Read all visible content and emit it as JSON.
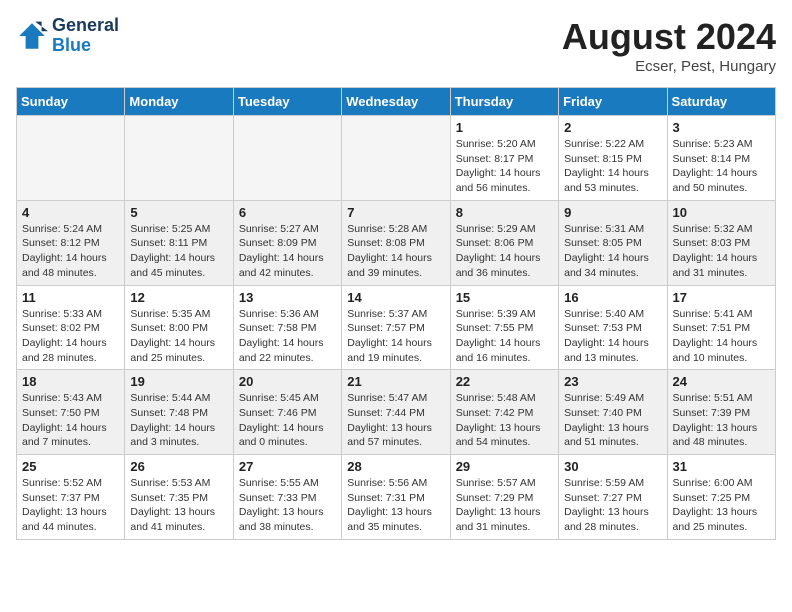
{
  "header": {
    "logo_line1": "General",
    "logo_line2": "Blue",
    "month": "August 2024",
    "location": "Ecser, Pest, Hungary"
  },
  "weekdays": [
    "Sunday",
    "Monday",
    "Tuesday",
    "Wednesday",
    "Thursday",
    "Friday",
    "Saturday"
  ],
  "weeks": [
    [
      {
        "day": "",
        "empty": true
      },
      {
        "day": "",
        "empty": true
      },
      {
        "day": "",
        "empty": true
      },
      {
        "day": "",
        "empty": true
      },
      {
        "day": "1",
        "sunrise": "Sunrise: 5:20 AM",
        "sunset": "Sunset: 8:17 PM",
        "daylight": "Daylight: 14 hours and 56 minutes."
      },
      {
        "day": "2",
        "sunrise": "Sunrise: 5:22 AM",
        "sunset": "Sunset: 8:15 PM",
        "daylight": "Daylight: 14 hours and 53 minutes."
      },
      {
        "day": "3",
        "sunrise": "Sunrise: 5:23 AM",
        "sunset": "Sunset: 8:14 PM",
        "daylight": "Daylight: 14 hours and 50 minutes."
      }
    ],
    [
      {
        "day": "4",
        "sunrise": "Sunrise: 5:24 AM",
        "sunset": "Sunset: 8:12 PM",
        "daylight": "Daylight: 14 hours and 48 minutes."
      },
      {
        "day": "5",
        "sunrise": "Sunrise: 5:25 AM",
        "sunset": "Sunset: 8:11 PM",
        "daylight": "Daylight: 14 hours and 45 minutes."
      },
      {
        "day": "6",
        "sunrise": "Sunrise: 5:27 AM",
        "sunset": "Sunset: 8:09 PM",
        "daylight": "Daylight: 14 hours and 42 minutes."
      },
      {
        "day": "7",
        "sunrise": "Sunrise: 5:28 AM",
        "sunset": "Sunset: 8:08 PM",
        "daylight": "Daylight: 14 hours and 39 minutes."
      },
      {
        "day": "8",
        "sunrise": "Sunrise: 5:29 AM",
        "sunset": "Sunset: 8:06 PM",
        "daylight": "Daylight: 14 hours and 36 minutes."
      },
      {
        "day": "9",
        "sunrise": "Sunrise: 5:31 AM",
        "sunset": "Sunset: 8:05 PM",
        "daylight": "Daylight: 14 hours and 34 minutes."
      },
      {
        "day": "10",
        "sunrise": "Sunrise: 5:32 AM",
        "sunset": "Sunset: 8:03 PM",
        "daylight": "Daylight: 14 hours and 31 minutes."
      }
    ],
    [
      {
        "day": "11",
        "sunrise": "Sunrise: 5:33 AM",
        "sunset": "Sunset: 8:02 PM",
        "daylight": "Daylight: 14 hours and 28 minutes."
      },
      {
        "day": "12",
        "sunrise": "Sunrise: 5:35 AM",
        "sunset": "Sunset: 8:00 PM",
        "daylight": "Daylight: 14 hours and 25 minutes."
      },
      {
        "day": "13",
        "sunrise": "Sunrise: 5:36 AM",
        "sunset": "Sunset: 7:58 PM",
        "daylight": "Daylight: 14 hours and 22 minutes."
      },
      {
        "day": "14",
        "sunrise": "Sunrise: 5:37 AM",
        "sunset": "Sunset: 7:57 PM",
        "daylight": "Daylight: 14 hours and 19 minutes."
      },
      {
        "day": "15",
        "sunrise": "Sunrise: 5:39 AM",
        "sunset": "Sunset: 7:55 PM",
        "daylight": "Daylight: 14 hours and 16 minutes."
      },
      {
        "day": "16",
        "sunrise": "Sunrise: 5:40 AM",
        "sunset": "Sunset: 7:53 PM",
        "daylight": "Daylight: 14 hours and 13 minutes."
      },
      {
        "day": "17",
        "sunrise": "Sunrise: 5:41 AM",
        "sunset": "Sunset: 7:51 PM",
        "daylight": "Daylight: 14 hours and 10 minutes."
      }
    ],
    [
      {
        "day": "18",
        "sunrise": "Sunrise: 5:43 AM",
        "sunset": "Sunset: 7:50 PM",
        "daylight": "Daylight: 14 hours and 7 minutes."
      },
      {
        "day": "19",
        "sunrise": "Sunrise: 5:44 AM",
        "sunset": "Sunset: 7:48 PM",
        "daylight": "Daylight: 14 hours and 3 minutes."
      },
      {
        "day": "20",
        "sunrise": "Sunrise: 5:45 AM",
        "sunset": "Sunset: 7:46 PM",
        "daylight": "Daylight: 14 hours and 0 minutes."
      },
      {
        "day": "21",
        "sunrise": "Sunrise: 5:47 AM",
        "sunset": "Sunset: 7:44 PM",
        "daylight": "Daylight: 13 hours and 57 minutes."
      },
      {
        "day": "22",
        "sunrise": "Sunrise: 5:48 AM",
        "sunset": "Sunset: 7:42 PM",
        "daylight": "Daylight: 13 hours and 54 minutes."
      },
      {
        "day": "23",
        "sunrise": "Sunrise: 5:49 AM",
        "sunset": "Sunset: 7:40 PM",
        "daylight": "Daylight: 13 hours and 51 minutes."
      },
      {
        "day": "24",
        "sunrise": "Sunrise: 5:51 AM",
        "sunset": "Sunset: 7:39 PM",
        "daylight": "Daylight: 13 hours and 48 minutes."
      }
    ],
    [
      {
        "day": "25",
        "sunrise": "Sunrise: 5:52 AM",
        "sunset": "Sunset: 7:37 PM",
        "daylight": "Daylight: 13 hours and 44 minutes."
      },
      {
        "day": "26",
        "sunrise": "Sunrise: 5:53 AM",
        "sunset": "Sunset: 7:35 PM",
        "daylight": "Daylight: 13 hours and 41 minutes."
      },
      {
        "day": "27",
        "sunrise": "Sunrise: 5:55 AM",
        "sunset": "Sunset: 7:33 PM",
        "daylight": "Daylight: 13 hours and 38 minutes."
      },
      {
        "day": "28",
        "sunrise": "Sunrise: 5:56 AM",
        "sunset": "Sunset: 7:31 PM",
        "daylight": "Daylight: 13 hours and 35 minutes."
      },
      {
        "day": "29",
        "sunrise": "Sunrise: 5:57 AM",
        "sunset": "Sunset: 7:29 PM",
        "daylight": "Daylight: 13 hours and 31 minutes."
      },
      {
        "day": "30",
        "sunrise": "Sunrise: 5:59 AM",
        "sunset": "Sunset: 7:27 PM",
        "daylight": "Daylight: 13 hours and 28 minutes."
      },
      {
        "day": "31",
        "sunrise": "Sunrise: 6:00 AM",
        "sunset": "Sunset: 7:25 PM",
        "daylight": "Daylight: 13 hours and 25 minutes."
      }
    ]
  ]
}
